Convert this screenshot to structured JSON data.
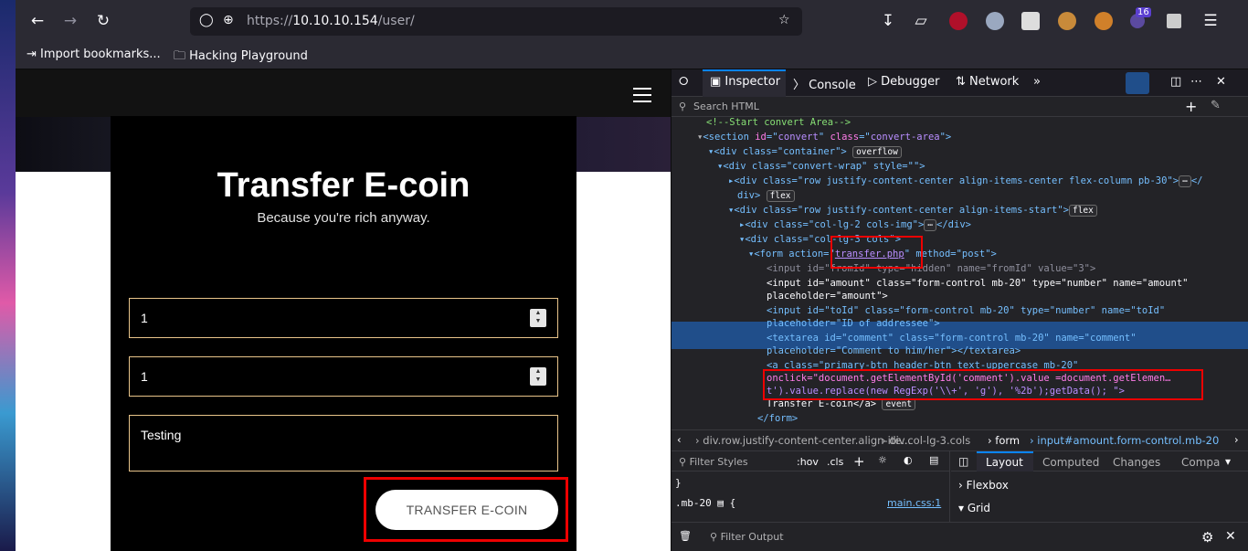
{
  "browser": {
    "url_host": "10.10.10.154",
    "url_prefix": "https://",
    "url_path": "/user/",
    "extension_badge": "16",
    "bookmarks": [
      "Import bookmarks...",
      "Hacking Playground"
    ]
  },
  "page": {
    "title": "Transfer E-coin",
    "subtitle": "Because you're rich anyway.",
    "amount_value": "1",
    "toid_value": "1",
    "comment_value": "Testing",
    "button_label": "TRANSFER E-COIN"
  },
  "devtools": {
    "tabs": [
      "Inspector",
      "Console",
      "Debugger",
      "Network"
    ],
    "search_placeholder": "Search HTML",
    "tree": {
      "l1": "<!--Start convert Area-->",
      "l2a": "<section ",
      "l2b": "id",
      "l2c": "=\"",
      "l2d": "convert",
      "l2e": "\" ",
      "l2f": "class",
      "l2g": "=\"",
      "l2h": "convert-area",
      "l2i": "\">",
      "l3": "<div class=\"container\">",
      "l3badge": "overflow",
      "l4": "<div class=\"convert-wrap\" style=\"\">",
      "l5": "<div class=\"row justify-content-center align-items-center flex-column pb-30\">",
      "l5end": "</",
      "l5b": "div>",
      "l5badge": "flex",
      "l6": "<div class=\"row justify-content-center align-items-start\">",
      "l6badge": "flex",
      "l7": "<div class=\"col-lg-2 cols-img\">",
      "l7end": "</div>",
      "l8": "<div class=\"col-lg-3 cols\">",
      "l9a": "<form action=\"",
      "l9b": "transfer.php",
      "l9c": "\" method=\"post\">",
      "l10": "<input id=\"fromId\" type=\"hidden\" name=\"fromId\" value=\"3\">",
      "l11": "<input id=\"amount\" class=\"form-control mb-20\" type=\"number\" name=\"amount\"",
      "l11b": "placeholder=\"amount\">",
      "l12": "<input id=\"toId\" class=\"form-control mb-20\" type=\"number\" name=\"toId\"",
      "l12b": "placeholder=\"ID of addressee\">",
      "l13": "<textarea id=\"comment\" class=\"form-control mb-20\" name=\"comment\"",
      "l13b": "placeholder=\"Comment to him/her\"></textarea>",
      "l14": "<a class=\"primary-btn header-btn text-uppercase mb-20\"",
      "l15": "onclick=\"document.getElementById('comment').value =document.getElemen…",
      "l16": "t').value.replace(new RegExp('\\\\+', 'g'), '%2b');getData(); \">",
      "l17": "Transfer E-coin</a>",
      "l17badge": "event",
      "l18": "</form>"
    },
    "breadcrumbs": [
      "div.row.justify-content-center.align-ite...",
      "div.col-lg-3.cols",
      "form",
      "input#amount.form-control.mb-20"
    ],
    "rules": {
      "filter_placeholder": "Filter Styles",
      "hov": ":hov",
      "cls": ".cls",
      "brace": "}",
      "selector": ".mb-20",
      "source": "main.css:1"
    },
    "layout_tabs": [
      "Layout",
      "Computed",
      "Changes",
      "Compa"
    ],
    "layout_sections": [
      "Flexbox",
      "Grid"
    ],
    "console_filter": "Filter Output"
  }
}
